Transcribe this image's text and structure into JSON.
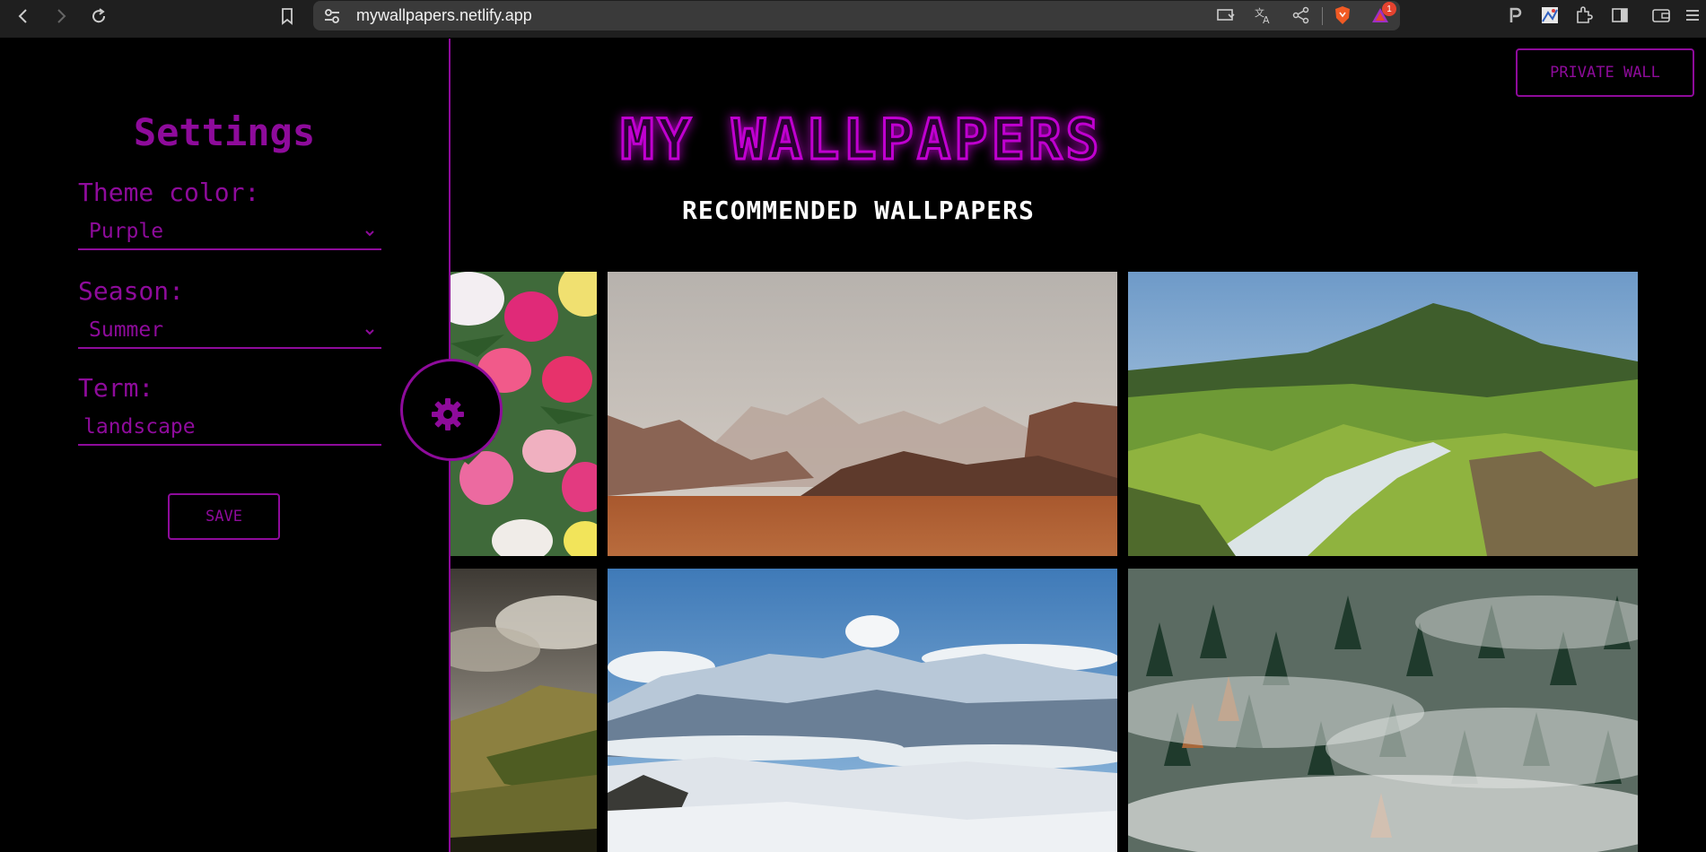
{
  "browser": {
    "url": "mywallpapers.netlify.app",
    "notification_count": "1"
  },
  "sidebar": {
    "title": "Settings",
    "theme_label": "Theme color:",
    "theme_value": "Purple",
    "season_label": "Season:",
    "season_value": "Summer",
    "term_label": "Term:",
    "term_value": "landscape",
    "save_label": "SAVE"
  },
  "header": {
    "private_label": "PRIVATE WALL",
    "logo_text": "MY WALLPAPERS",
    "subtitle": "RECOMMENDED WALLPAPERS"
  },
  "colors": {
    "accent": "#8e0b9b",
    "logo_glow": "#c000d0",
    "background": "#000000"
  },
  "wallpapers": [
    {
      "subject": "tulips"
    },
    {
      "subject": "desert-mountains"
    },
    {
      "subject": "green-valley-river"
    },
    {
      "subject": "cloudy-hills"
    },
    {
      "subject": "snowy-alps"
    },
    {
      "subject": "misty-forest"
    }
  ]
}
